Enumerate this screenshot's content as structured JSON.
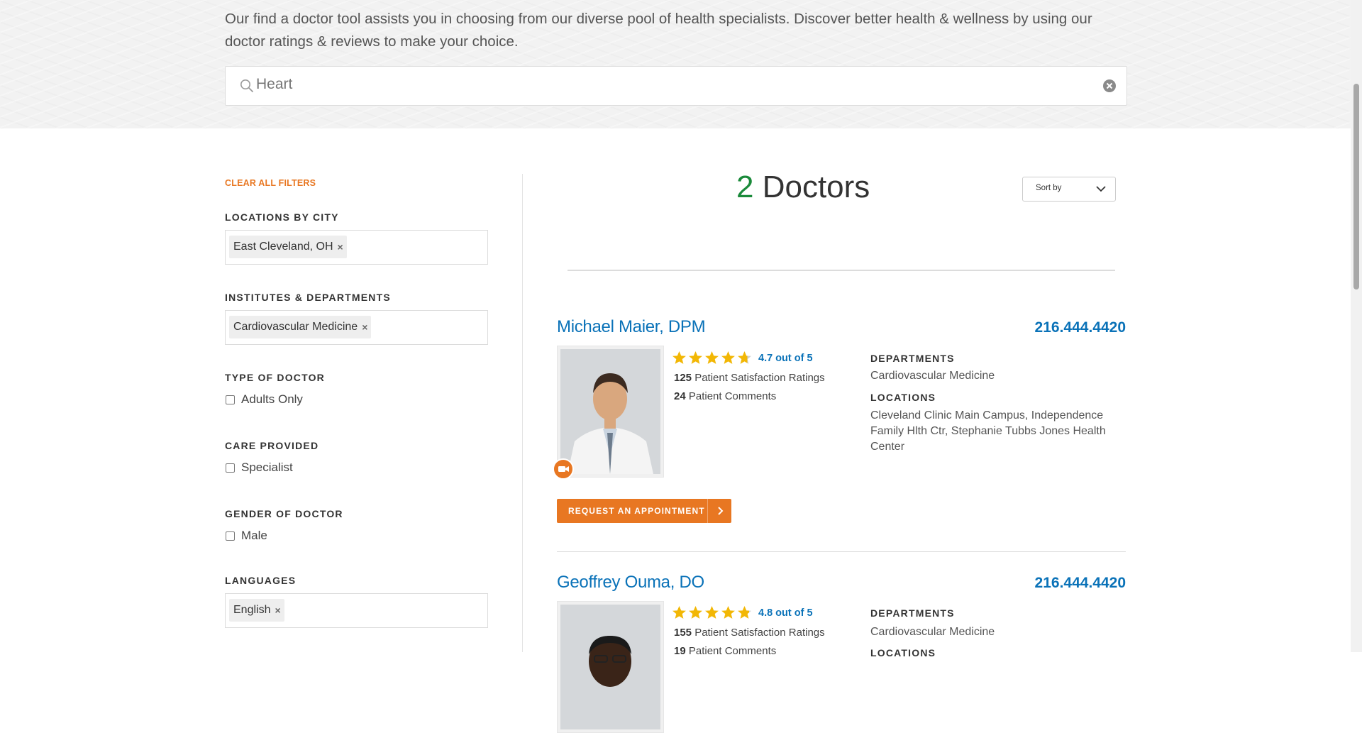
{
  "intro": {
    "text": "Our find a doctor tool assists you in choosing from our diverse pool of health specialists. Discover better health & wellness by using our doctor ratings & reviews to make your choice."
  },
  "search": {
    "value": "Heart"
  },
  "filters": {
    "clear_all": "CLEAR ALL FILTERS",
    "locations_heading": "LOCATIONS BY CITY",
    "location_token": "East Cleveland, OH",
    "institutes_heading": "INSTITUTES & DEPARTMENTS",
    "institute_token": "Cardiovascular Medicine",
    "type_heading": "TYPE OF DOCTOR",
    "type_option": "Adults Only",
    "care_heading": "CARE PROVIDED",
    "care_option": "Specialist",
    "gender_heading": "GENDER OF DOCTOR",
    "gender_option": "Male",
    "languages_heading": "LANGUAGES",
    "language_token": "English",
    "remove_glyph": "×"
  },
  "results": {
    "count": "2",
    "count_label": " Doctors",
    "sort_label": "Sort by"
  },
  "doctors": [
    {
      "name": "Michael Maier, DPM",
      "phone": "216.444.4420",
      "rating": 4.7,
      "rating_text": "4.7 out of 5",
      "ratings_count": "125",
      "ratings_label": " Patient Satisfaction Ratings",
      "comments_count": "24",
      "comments_label": " Patient Comments",
      "departments_heading": "DEPARTMENTS",
      "departments": "Cardiovascular Medicine",
      "locations_heading": "LOCATIONS",
      "locations": "Cleveland Clinic Main Campus, Independence Family Hlth Ctr, Stephanie Tubbs Jones Health Center",
      "appointment_label": "REQUEST AN APPOINTMENT",
      "video_visit": true
    },
    {
      "name": "Geoffrey Ouma, DO",
      "phone": "216.444.4420",
      "rating": 4.8,
      "rating_text": "4.8 out of 5",
      "ratings_count": "155",
      "ratings_label": " Patient Satisfaction Ratings",
      "comments_count": "19",
      "comments_label": " Patient Comments",
      "departments_heading": "DEPARTMENTS",
      "departments": "Cardiovascular Medicine",
      "locations_heading": "LOCATIONS"
    }
  ],
  "colors": {
    "accent_orange": "#e87722",
    "link_blue": "#0a72b8",
    "count_green": "#1a8a3a",
    "star_gold": "#f2b705"
  },
  "icons": [
    "search-icon",
    "clear-icon",
    "chevron-down-icon",
    "star-icon",
    "video-camera-icon",
    "chevron-right-icon",
    "remove-icon"
  ]
}
